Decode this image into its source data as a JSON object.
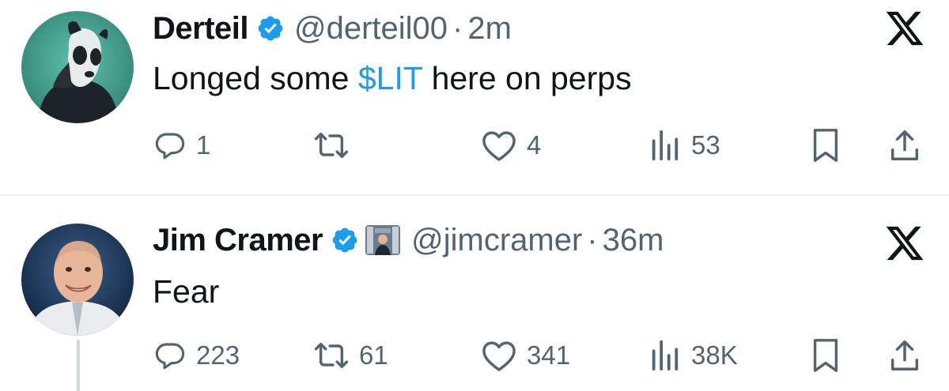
{
  "tweets": [
    {
      "name": "Derteil",
      "handle": "@derteil00",
      "separator": "·",
      "time": "2m",
      "text_before": "Longed some ",
      "cashtag": "$LIT",
      "text_after": " here on perps",
      "replies": "1",
      "retweets": "",
      "likes": "4",
      "views": "53"
    },
    {
      "name": "Jim Cramer",
      "handle": "@jimcramer",
      "separator": "·",
      "time": "36m",
      "text": "Fear",
      "replies": "223",
      "retweets": "61",
      "likes": "341",
      "views": "38K"
    }
  ],
  "icons": {
    "verified": "verified-badge-icon",
    "reply": "reply-icon",
    "retweet": "retweet-icon",
    "like": "heart-icon",
    "views": "views-icon",
    "bookmark": "bookmark-icon",
    "share": "share-icon",
    "platform": "x-logo-icon"
  },
  "colors": {
    "verified": "#1d9bf0",
    "cashtag": "#1d9bf0",
    "secondary_text": "#536471",
    "primary_text": "#0f1419"
  }
}
